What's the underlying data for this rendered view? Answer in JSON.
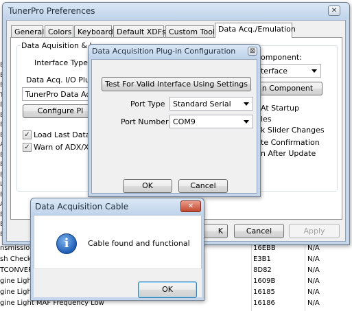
{
  "background_list": {
    "rows": [
      {
        "name": "nsmission",
        "code": "16EBB",
        "status": "N/A"
      },
      {
        "name": "sh Checks",
        "code": "E3B1",
        "status": "N/A"
      },
      {
        "name": "TCONVER",
        "code": "8D82",
        "status": "N/A"
      },
      {
        "name": "gine Light",
        "code": "1609B",
        "status": "N/A"
      },
      {
        "name": "gine Light",
        "code": "16185",
        "status": "N/A"
      },
      {
        "name": "gine Light MAF Frequency Low",
        "code": "16186",
        "status": "N/A"
      }
    ],
    "left_fragments": [
      "E",
      "E",
      "E",
      "T",
      "E",
      "E",
      "E",
      "E",
      "A",
      "E",
      "E",
      "E",
      "L",
      "E",
      "A",
      "E",
      "E",
      "E"
    ]
  },
  "prefs_window": {
    "title": "TunerPro Preferences",
    "close_glyph": "✕",
    "tabs": [
      {
        "label": "General"
      },
      {
        "label": "Colors"
      },
      {
        "label": "Keyboard"
      },
      {
        "label": "Default XDFs"
      },
      {
        "label": "Custom Tools"
      },
      {
        "label": "Data Acq./Emulation"
      }
    ],
    "group_left_label": "Data Aquisition & Lo",
    "interface_type_label": "Interface Type",
    "plugin_label": "Data Acq. I/O Plug-",
    "plugin_value": "TunerPro Data Acqu",
    "configure_button": "Configure Pl",
    "load_last_label": "Load Last Data A",
    "warn_label": "Warn of ADX/XDF",
    "right_component_label": "omponent:",
    "right_combo_value": "nterface",
    "right_button": "n Component",
    "right_options": [
      "At Startup",
      "les",
      "k Slider Changes",
      "te Confirmation",
      "n After Update"
    ],
    "ok_button": "K",
    "cancel_button": "Cancel",
    "apply_button": "Apply",
    "check_glyph": "✓"
  },
  "config_dialog": {
    "title": "Data Acquisition Plug-in Configuration",
    "close_glyph": "⊠",
    "test_button": "Test For Valid Interface Using Settings",
    "port_type_label": "Port Type",
    "port_type_value": "Standard Serial",
    "port_number_label": "Port Number",
    "port_number_value": "COM9",
    "ok_button": "OK",
    "cancel_button": "Cancel"
  },
  "cable_dialog": {
    "title": "Data Acquisition Cable",
    "close_glyph": "✕",
    "icon_glyph": "i",
    "message": "Cable found and functional",
    "ok_button": "OK"
  }
}
